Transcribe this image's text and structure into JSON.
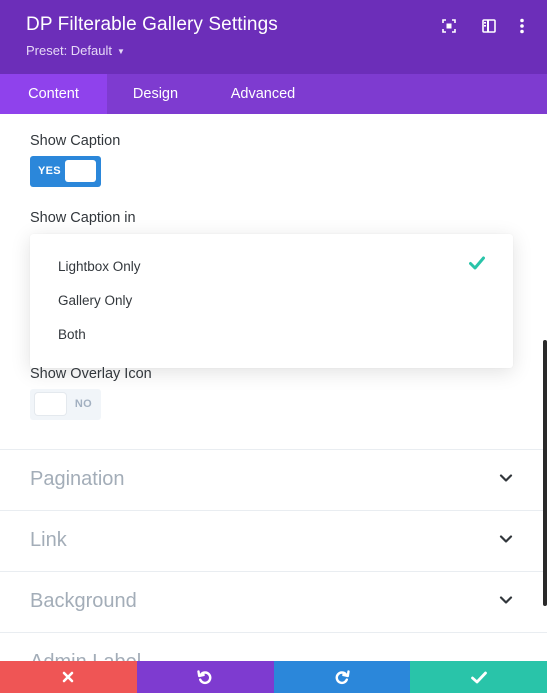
{
  "header": {
    "title": "DP Filterable Gallery Settings",
    "preset": "Preset: Default",
    "icons": [
      "focus-icon",
      "sidebar-layout-icon",
      "more-vertical-icon"
    ]
  },
  "tabs": [
    {
      "label": "Content",
      "active": true
    },
    {
      "label": "Design",
      "active": false
    },
    {
      "label": "Advanced",
      "active": false
    }
  ],
  "fields": {
    "show_caption": {
      "label": "Show Caption",
      "toggle_text": "YES",
      "value": true
    },
    "show_caption_in": {
      "label": "Show Caption in",
      "options": [
        "Lightbox Only",
        "Gallery Only",
        "Both"
      ],
      "selected": "Lightbox Only"
    },
    "show_overlay_icon": {
      "label": "Show Overlay Icon",
      "toggle_text": "NO",
      "value": false
    }
  },
  "sections": [
    {
      "title": "Pagination"
    },
    {
      "title": "Link"
    },
    {
      "title": "Background"
    },
    {
      "title": "Admin Label"
    }
  ],
  "bottom_bar": {
    "buttons": [
      {
        "name": "cancel-button",
        "icon": "close-icon",
        "color": "#ef5555"
      },
      {
        "name": "undo-button",
        "icon": "undo-icon",
        "color": "#7e3bd0"
      },
      {
        "name": "redo-button",
        "icon": "redo-icon",
        "color": "#2b87da"
      },
      {
        "name": "save-button",
        "icon": "check-icon",
        "color": "#29c4a9"
      }
    ]
  },
  "colors": {
    "header": "#6c2eb9",
    "tabs": "#7e3bd0",
    "active_tab": "#8f42ec",
    "toggle_on": "#2b87da",
    "check": "#29c4a9"
  }
}
